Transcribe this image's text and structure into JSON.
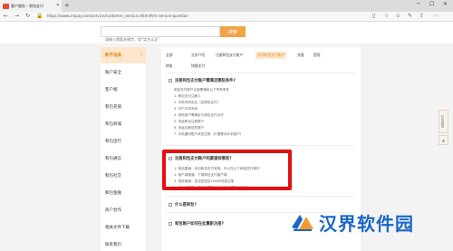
{
  "browser": {
    "tab_title": "客户服务 - 和包支付",
    "url": "https://www.cmpay.com/service/customer_service.xhtml#/m-service-question"
  },
  "header": {
    "search_placeholder": "请输入搜索关键字，如“实名认证”",
    "search_button": "搜索"
  },
  "sidebar": {
    "items": [
      {
        "label": "新手指南",
        "active": true
      },
      {
        "label": "账户安全"
      },
      {
        "label": "客户端"
      },
      {
        "label": "和包充值"
      },
      {
        "label": "和包商城"
      },
      {
        "label": "和包出行"
      },
      {
        "label": "和包通信"
      },
      {
        "label": "和包社交"
      },
      {
        "label": "和包金融"
      },
      {
        "label": "商户合作"
      },
      {
        "label": "相关文件下载"
      },
      {
        "label": "联系我们"
      }
    ]
  },
  "categories": {
    "row1": [
      "全部",
      "业务介绍",
      "注册和包支付账户",
      "访问和包支付账户",
      "充值",
      "提现"
    ],
    "row2": [
      "转账",
      "快捷支付"
    ]
  },
  "q1": {
    "title": "注册和包支付账户需满足哪些条件?",
    "lines": [
      "和包支付账户注册需满足以下所有条件",
      "1. 和包支付注册人",
      "2. 手机号码实名（如和包支付）",
      "3. 开户手机号码",
      "4. 其他用户需满足与和包支付合作",
      "5. 未经和包注册账户",
      "6. 未经过和包的账户",
      "7. 手机通讯账户状态正常（中国移动手机用户）"
    ]
  },
  "q2": {
    "title": "注册和包支付账户的渠道有哪些?",
    "lines": [
      "1. 网站渠道：访问和包支付官网，可以在以下网站进行操作",
      "2. 客户端渠道：下载和包支付客户端",
      "3. 短信渠道：发送短信至10086完成注册",
      "4. 营业厅渠道：前往中国移动营业厅办理和包支付"
    ]
  },
  "q3": {
    "title": "什么是和包?"
  },
  "q4": {
    "title": "和包账户如何在此重新注册?"
  },
  "side_widget": {
    "label": "在线客服",
    "top_label": "▲"
  },
  "watermark": {
    "text": "汉界软件园"
  }
}
